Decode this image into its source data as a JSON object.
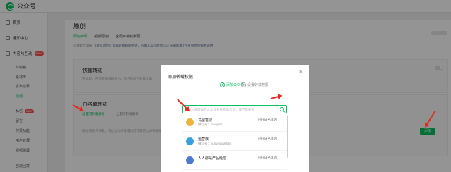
{
  "app": {
    "name": "公众号"
  },
  "sidebar": {
    "items": [
      {
        "label": "首页"
      },
      {
        "label": "通知中心"
      },
      {
        "label": "内容与互动",
        "badge": "NEW"
      }
    ],
    "subitems": [
      "草稿箱",
      "素材库",
      "发表记录",
      "原创"
    ],
    "lower_items": [
      {
        "label": "私信",
        "badge": "NEW"
      },
      {
        "label": "留言"
      },
      {
        "label": "付费功能"
      },
      {
        "label": "用户管理"
      },
      {
        "label": "视频弹幕"
      },
      {
        "label": "自动回复"
      }
    ]
  },
  "main": {
    "title": "原创",
    "tabs": [
      "原创声明",
      "视频原创",
      "全局可转载账号"
    ],
    "notice_prefix": "可转载文章来",
    "notice_link": "《微信原创》设置转载规则申请，有关入口在原创 [人] 长期版本 [?]",
    "notice_suffix": "查看原创规则说明",
    "quick_reprint": {
      "title": "快捷转载",
      "desc": "在此处，所有转载规则设为，而且快捷已转载文章"
    },
    "whitelist": {
      "title": "白名单转载",
      "subtabs": [
        "设置可转载账号",
        "全部可转载账号"
      ],
      "desc": "通过白名单转载，可以为公众号增加可转载的公众号账号",
      "add_button": "添加"
    }
  },
  "modal": {
    "title": "添加转载权限",
    "close": "×",
    "steps": [
      {
        "num": "1",
        "label": "添加公众号"
      },
      {
        "num": "2",
        "label": "设置转载权限"
      }
    ],
    "search_placeholder": "请输入要转载的公众号名称或微信号，按回车搜索",
    "results": [
      {
        "name": "鸟屋笔记",
        "id": "微信号：niaoge8",
        "status": "已在白名单内"
      },
      {
        "name": "运营族",
        "id": "微信号：yunyingpai666",
        "status": "已在白名单内"
      },
      {
        "name": "人人都是产品经理",
        "id": "",
        "status": "已在白名单内"
      }
    ]
  },
  "colors": {
    "accent": "#07c160",
    "arrow": "#e02a1f",
    "badge": "#fa5151"
  }
}
